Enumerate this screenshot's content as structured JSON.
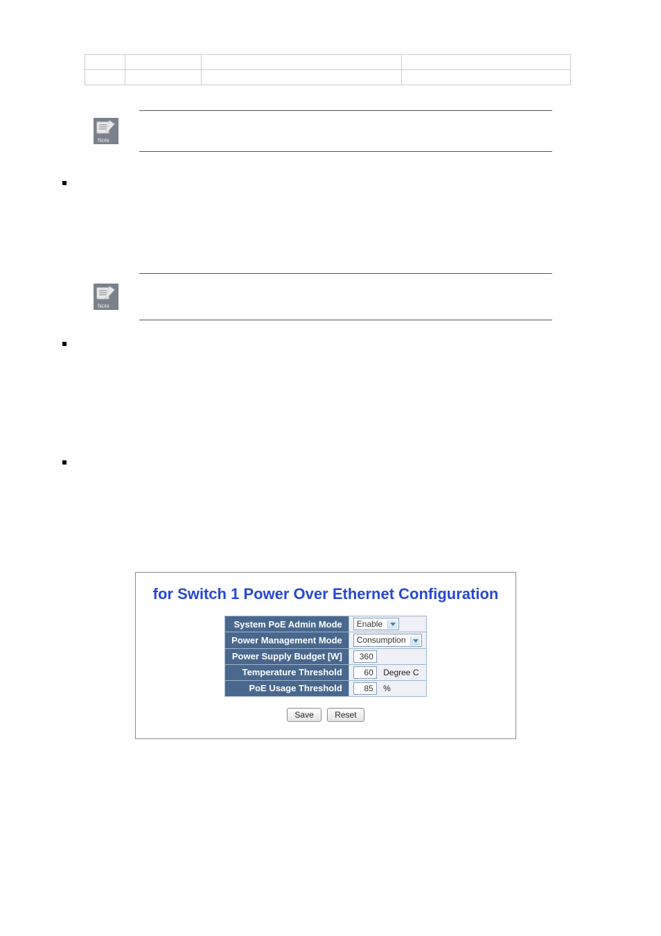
{
  "note_label": "Note",
  "screenshot": {
    "title": "for Switch 1 Power Over Ethernet Configuration",
    "rows": [
      {
        "label": "System PoE Admin Mode",
        "value": "Enable",
        "type": "select"
      },
      {
        "label": "Power Management Mode",
        "value": "Consumption",
        "type": "select"
      },
      {
        "label": "Power Supply Budget [W]",
        "value": "360",
        "type": "input"
      },
      {
        "label": "Temperature Threshold",
        "value": "60",
        "type": "input",
        "unit": "Degree C"
      },
      {
        "label": "PoE Usage Threshold",
        "value": "85",
        "type": "input",
        "unit": "%"
      }
    ],
    "buttons": {
      "save": "Save",
      "reset": "Reset"
    }
  }
}
